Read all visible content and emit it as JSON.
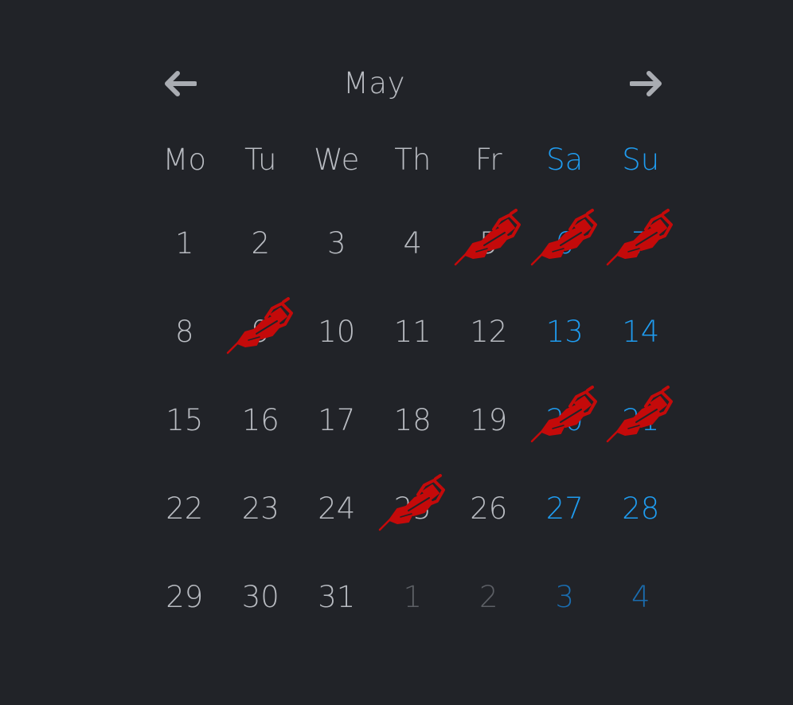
{
  "calendar": {
    "month": "May",
    "prev_icon": "arrow-left-icon",
    "next_icon": "arrow-right-icon",
    "weekdays": [
      "Mo",
      "Tu",
      "We",
      "Th",
      "Fr",
      "Sa",
      "Su"
    ],
    "mark_icon": "tattoo-machine-icon",
    "colors": {
      "background": "#212328",
      "text": "#b9bcc2",
      "weekend": "#1f9cf0",
      "outside": "#5d6066",
      "outside_weekend": "#1a6db0",
      "mark": "#c40a0a"
    },
    "weeks": [
      [
        {
          "day": "1"
        },
        {
          "day": "2"
        },
        {
          "day": "3"
        },
        {
          "day": "4"
        },
        {
          "day": "5",
          "marked": true
        },
        {
          "day": "6",
          "marked": true
        },
        {
          "day": "7",
          "marked": true
        }
      ],
      [
        {
          "day": "8"
        },
        {
          "day": "9",
          "marked": true
        },
        {
          "day": "10"
        },
        {
          "day": "11"
        },
        {
          "day": "12"
        },
        {
          "day": "13"
        },
        {
          "day": "14"
        }
      ],
      [
        {
          "day": "15"
        },
        {
          "day": "16"
        },
        {
          "day": "17"
        },
        {
          "day": "18"
        },
        {
          "day": "19"
        },
        {
          "day": "20",
          "marked": true
        },
        {
          "day": "21",
          "marked": true
        }
      ],
      [
        {
          "day": "22"
        },
        {
          "day": "23"
        },
        {
          "day": "24"
        },
        {
          "day": "25",
          "marked": true
        },
        {
          "day": "26"
        },
        {
          "day": "27"
        },
        {
          "day": "28"
        }
      ],
      [
        {
          "day": "29"
        },
        {
          "day": "30"
        },
        {
          "day": "31"
        },
        {
          "day": "1",
          "outside": true
        },
        {
          "day": "2",
          "outside": true
        },
        {
          "day": "3",
          "outside": true
        },
        {
          "day": "4",
          "outside": true
        }
      ]
    ]
  }
}
